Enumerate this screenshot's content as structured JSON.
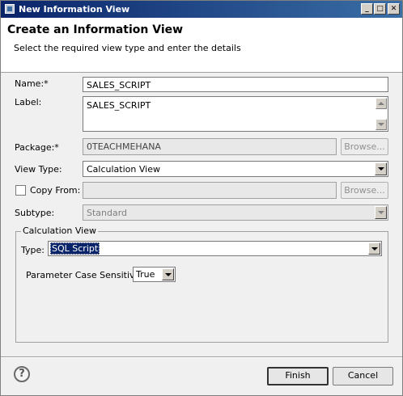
{
  "window": {
    "title": "New Information View"
  },
  "header": {
    "title": "Create an Information View",
    "description": "Select the required view type and enter the details"
  },
  "form": {
    "name": {
      "label": "Name:*",
      "value": "SALES_SCRIPT"
    },
    "label_field": {
      "label": "Label:",
      "value": "SALES_SCRIPT"
    },
    "package": {
      "label": "Package:*",
      "value": "0TEACHMEHANA",
      "browse_label": "Browse..."
    },
    "view_type": {
      "label": "View Type:",
      "value": "Calculation View"
    },
    "copy_from": {
      "label": "Copy From:",
      "value": "",
      "browse_label": "Browse...",
      "checked": false
    },
    "subtype": {
      "label": "Subtype:",
      "value": "Standard"
    }
  },
  "calculation_view": {
    "group_label": "Calculation View",
    "type": {
      "label": "Type:",
      "value": "SQL Script"
    },
    "param_case": {
      "label": "Parameter Case Sensitive:",
      "value": "True"
    }
  },
  "footer": {
    "help_glyph": "?",
    "finish_label": "Finish",
    "cancel_label": "Cancel"
  },
  "titlebar_buttons": {
    "minimize": "_",
    "maximize": "□",
    "close": "✕"
  }
}
